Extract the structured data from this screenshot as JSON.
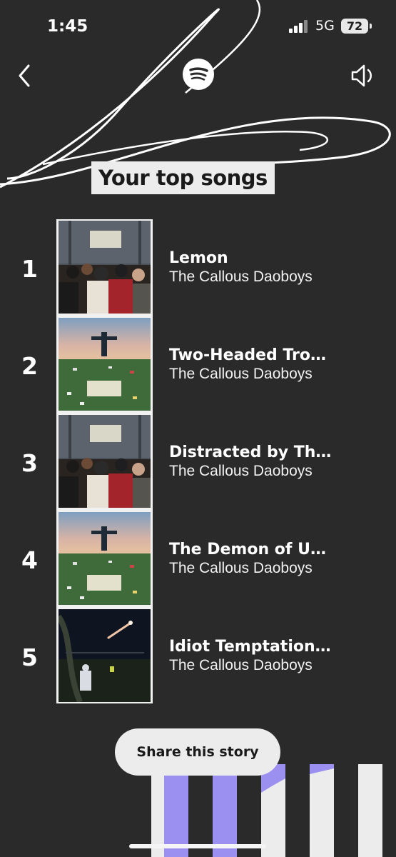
{
  "status": {
    "time": "1:45",
    "network": "5G",
    "battery": "72"
  },
  "header": {
    "title": "Your top songs"
  },
  "songs": [
    {
      "rank": "1",
      "title": "Lemon",
      "artist": "The Callous Daoboys",
      "cover": "crowd"
    },
    {
      "rank": "2",
      "title": "Two-Headed Tro…",
      "artist": "The Callous Daoboys",
      "cover": "field"
    },
    {
      "rank": "3",
      "title": "Distracted by Th…",
      "artist": "The Callous Daoboys",
      "cover": "crowd"
    },
    {
      "rank": "4",
      "title": "The Demon of U…",
      "artist": "The Callous Daoboys",
      "cover": "field"
    },
    {
      "rank": "5",
      "title": "Idiot Temptation…",
      "artist": "The Callous Daoboys",
      "cover": "night"
    }
  ],
  "actions": {
    "share_label": "Share this story"
  },
  "colors": {
    "background": "#2a2a2a",
    "accent": "#9b8ff0",
    "light": "#ececec"
  }
}
